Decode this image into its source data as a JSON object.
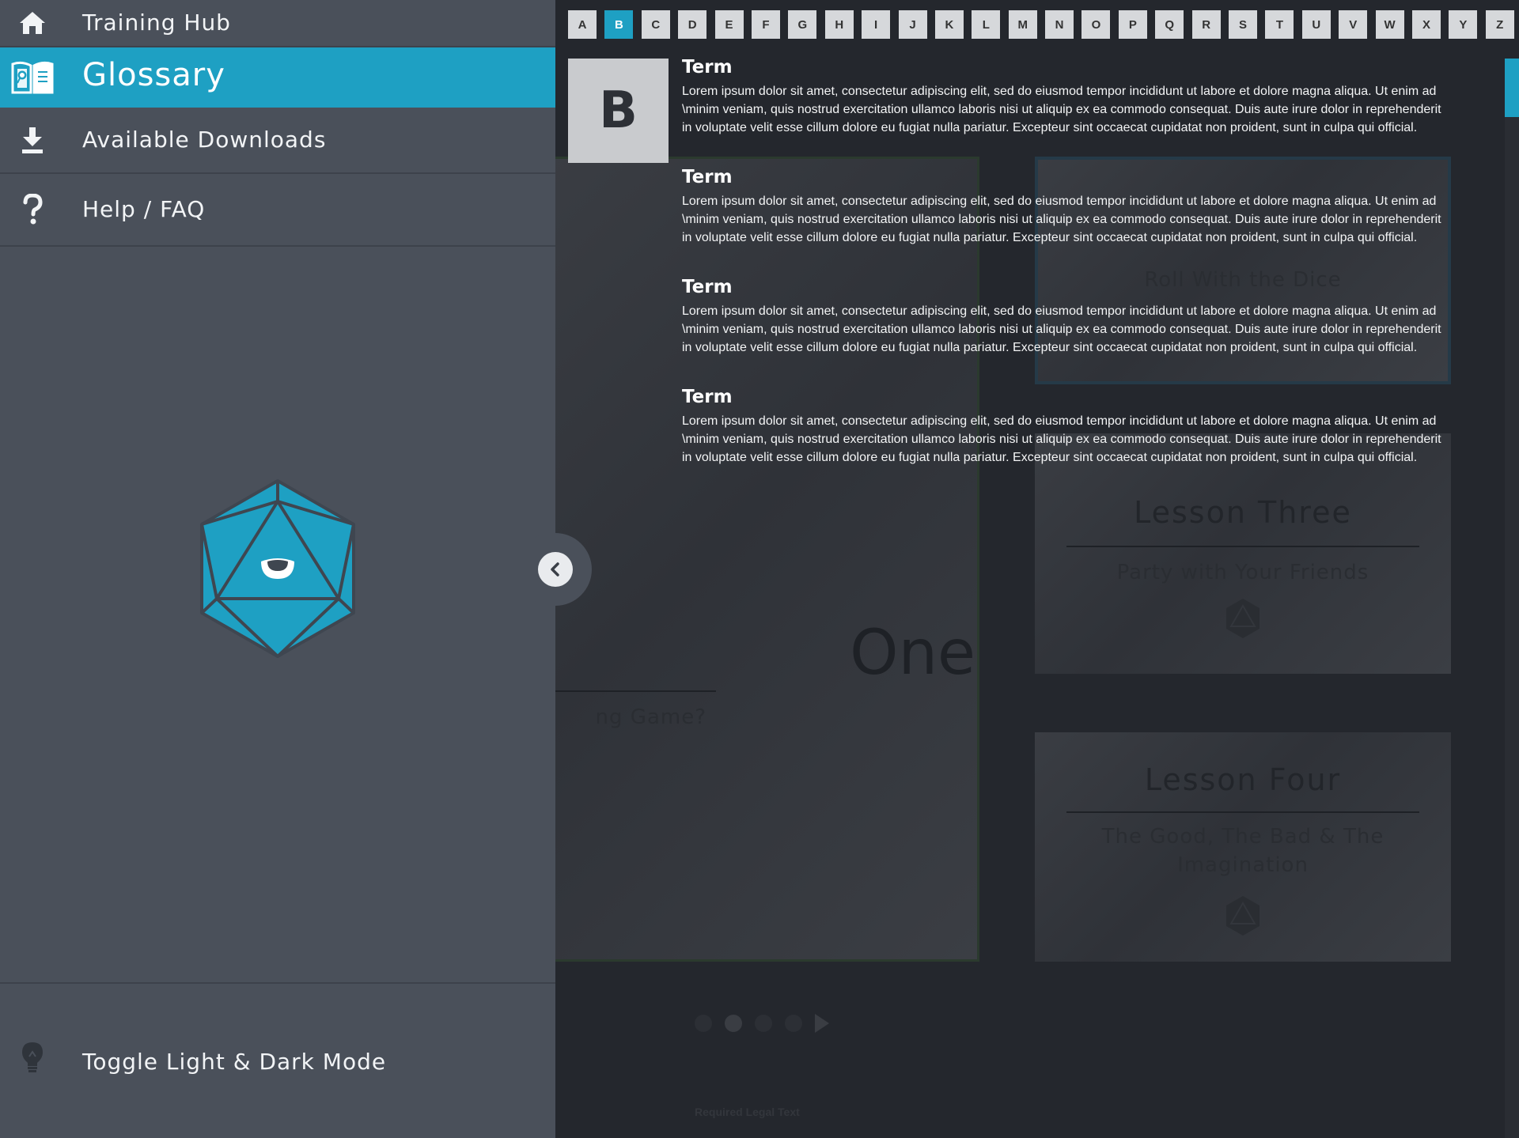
{
  "nav": {
    "home_label": "Training Hub",
    "glossary_label": "Glossary",
    "downloads_label": "Available Downloads",
    "help_label": "Help / FAQ",
    "toggle_label": "Toggle Light & Dark Mode",
    "active": "glossary"
  },
  "alphabet": [
    "A",
    "B",
    "C",
    "D",
    "E",
    "F",
    "G",
    "H",
    "I",
    "J",
    "K",
    "L",
    "M",
    "N",
    "O",
    "P",
    "Q",
    "R",
    "S",
    "T",
    "U",
    "V",
    "W",
    "X",
    "Y",
    "Z"
  ],
  "selected_letter": "B",
  "glossary": [
    {
      "term": "Term",
      "definition": "Lorem ipsum dolor sit amet, consectetur adipiscing elit, sed do eiusmod tempor incididunt ut labore et dolore magna aliqua. Ut enim ad \\minim veniam, quis nostrud exercitation ullamco laboris nisi ut aliquip ex ea commodo consequat. Duis aute irure dolor in reprehenderit in voluptate velit esse cillum dolore eu fugiat nulla pariatur. Excepteur sint occaecat cupidatat non proident, sunt in culpa qui official."
    },
    {
      "term": "Term",
      "definition": "Lorem ipsum dolor sit amet, consectetur adipiscing elit, sed do eiusmod tempor incididunt ut labore et dolore magna aliqua. Ut enim ad \\minim veniam, quis nostrud exercitation ullamco laboris nisi ut aliquip ex ea commodo consequat. Duis aute irure dolor in reprehenderit in voluptate velit esse cillum dolore eu fugiat nulla pariatur. Excepteur sint occaecat cupidatat non proident, sunt in culpa qui official."
    },
    {
      "term": "Term",
      "definition": "Lorem ipsum dolor sit amet, consectetur adipiscing elit, sed do eiusmod tempor incididunt ut labore et dolore magna aliqua. Ut enim ad \\minim veniam, quis nostrud exercitation ullamco laboris nisi ut aliquip ex ea commodo consequat. Duis aute irure dolor in reprehenderit in voluptate velit esse cillum dolore eu fugiat nulla pariatur. Excepteur sint occaecat cupidatat non proident, sunt in culpa qui official."
    },
    {
      "term": "Term",
      "definition": "Lorem ipsum dolor sit amet, consectetur adipiscing elit, sed do eiusmod tempor incididunt ut labore et dolore magna aliqua. Ut enim ad \\minim veniam, quis nostrud exercitation ullamco laboris nisi ut aliquip ex ea commodo consequat. Duis aute irure dolor in reprehenderit in voluptate velit esse cillum dolore eu fugiat nulla pariatur. Excepteur sint occaecat cupidatat non proident, sunt in culpa qui official."
    }
  ],
  "background": {
    "lesson_one_title": "One",
    "lesson_one_sub": "ng Game?",
    "lesson_two_sub": "Roll With the Dice",
    "lesson_three_title": "Lesson Three",
    "lesson_three_sub": "Party with Your Friends",
    "lesson_four_title": "Lesson Four",
    "lesson_four_sub": "The Good, The Bad & The Imagination",
    "legal": "Required Legal Text"
  },
  "colors": {
    "accent": "#1ea0c3",
    "sidebar": "#4a505a",
    "overlay_bg": "#24272d"
  },
  "icons": {
    "home": "home-icon",
    "glossary": "book-magnifier-icon",
    "downloads": "download-icon",
    "help": "question-icon",
    "toggle": "lightbulb-icon",
    "collapse": "chevron-left-icon",
    "logo": "d20-eye-logo"
  }
}
